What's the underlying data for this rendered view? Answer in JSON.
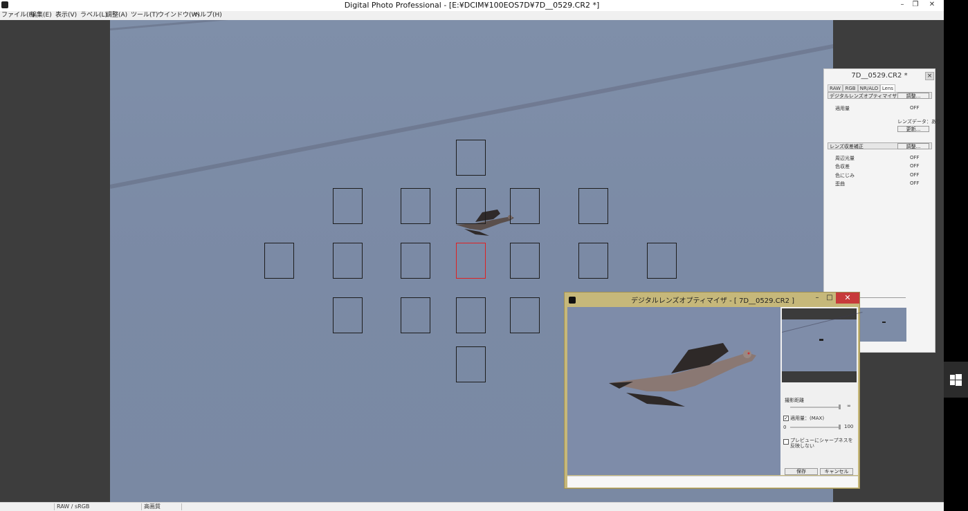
{
  "app": {
    "title": "Digital Photo Professional - [E:¥DCIM¥100EOS7D¥7D__0529.CR2 *]",
    "window_controls": {
      "minimize": "–",
      "restore": "❐",
      "close": "✕"
    }
  },
  "menu": [
    "ファイル(F)",
    "編集(E)",
    "表示(V)",
    "ラベル(L)",
    "調整(A)",
    "ツール(T)",
    "ウインドウ(W)",
    "ヘルプ(H)"
  ],
  "status": {
    "format": "RAW / sRGB",
    "quality": "高画質"
  },
  "af_points": {
    "active_label": "active"
  },
  "palette": {
    "title": "7D__0529.CR2 *",
    "close": "×",
    "tabs": [
      "RAW",
      "RGB",
      "NR/ALO",
      "Lens"
    ],
    "active_tab": "Lens",
    "dlo": {
      "header": "デジタルレンズオプティマイザ",
      "adjust": "調整...",
      "amount_label": "適用量",
      "amount_value": "OFF",
      "lens_data": "レンズデータ：あり",
      "update": "更新..."
    },
    "aberration": {
      "header": "レンズ収差補正",
      "adjust": "調整...",
      "items": [
        {
          "label": "周辺光量",
          "value": "OFF"
        },
        {
          "label": "色収差",
          "value": "OFF"
        },
        {
          "label": "色にじみ",
          "value": "OFF"
        },
        {
          "label": "歪曲",
          "value": "OFF"
        }
      ]
    }
  },
  "dlo_dialog": {
    "title": "デジタルレンズオプティマイザ - [ 7D__0529.CR2 ]",
    "minimize": "–",
    "maximize": "□",
    "close": "✕",
    "distance_label": "撮影距離",
    "distance_end": "∞",
    "amount_checkbox_label": "適用量：(MAX)",
    "amount_checked": "✓",
    "amount_min": "0",
    "amount_max": "100",
    "sharpness_checkbox_label": "プレビューにシャープネスを反映しない",
    "save": "保存",
    "cancel": "キャンセル"
  },
  "colors": {
    "sky": "#7d8ca7",
    "active_af": "#e02020",
    "dialog_frame": "#c6b87a",
    "close_red": "#c73a3a"
  }
}
